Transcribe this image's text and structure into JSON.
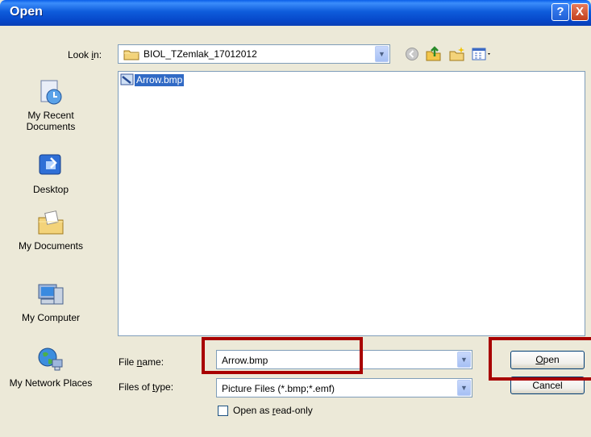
{
  "window": {
    "title": "Open",
    "help_label": "?",
    "close_label": "X"
  },
  "lookin": {
    "label": "Look in:",
    "folder": "BIOL_TZemlak_17012012"
  },
  "toolbar": {
    "icons": [
      "back-icon",
      "up-folder-icon",
      "new-folder-icon",
      "views-menu-icon"
    ]
  },
  "places": [
    {
      "label": "My Recent Documents",
      "icon": "recent-documents-icon"
    },
    {
      "label": "Desktop",
      "icon": "desktop-icon"
    },
    {
      "label": "My Documents",
      "icon": "my-documents-icon"
    },
    {
      "label": "My Computer",
      "icon": "my-computer-icon"
    },
    {
      "label": "My Network Places",
      "icon": "network-places-icon"
    }
  ],
  "files": [
    {
      "name": "Arrow.bmp",
      "selected": true
    }
  ],
  "filename": {
    "label": "File name:",
    "value": "Arrow.bmp"
  },
  "filetype": {
    "label": "Files of type:",
    "value": "Picture Files (*.bmp;*.emf)"
  },
  "readonly": {
    "label": "Open as read-only",
    "checked": false
  },
  "buttons": {
    "open": "Open",
    "cancel": "Cancel"
  },
  "annotation_color": "#a80000"
}
